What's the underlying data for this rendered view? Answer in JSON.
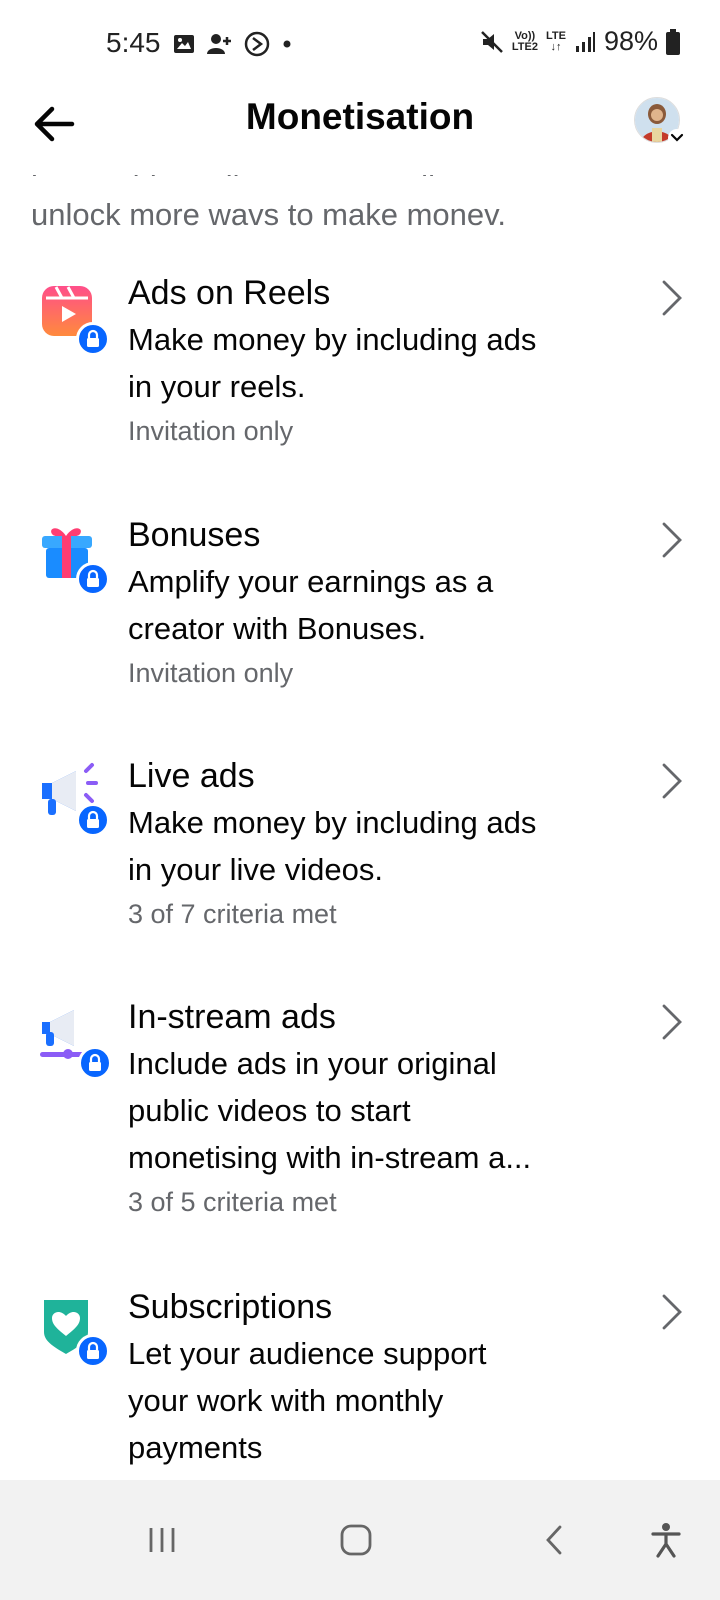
{
  "status_bar": {
    "time": "5:45",
    "net_volte": "Vo))",
    "net_lte2": "LTE2",
    "net_lte": "LTE",
    "battery": "98%",
    "icons": [
      "gallery-icon",
      "person-add-icon",
      "sync-icon",
      "dot-icon",
      "mute-icon",
      "signal-icon",
      "battery-icon"
    ]
  },
  "header": {
    "title": "Monetisation",
    "back_icon": "arrow-left-icon",
    "avatar_caret_icon": "chevron-down-icon"
  },
  "intro": {
    "clipped_line": "by reaching milestones, you'll",
    "visible_line": "unlock more wavs to make monev."
  },
  "items": [
    {
      "title": "Ads on Reels",
      "desc_1": "Make money by including ads",
      "desc_2": "in your reels.",
      "desc_3": "",
      "status": "Invitation only",
      "icon": "reels-icon"
    },
    {
      "title": "Bonuses",
      "desc_1": "Amplify your earnings as a",
      "desc_2": "creator with Bonuses.",
      "desc_3": "",
      "status": "Invitation only",
      "icon": "gift-icon"
    },
    {
      "title": "Live ads",
      "desc_1": "Make money by including ads",
      "desc_2": "in your live videos.",
      "desc_3": "",
      "status": "3 of 7 criteria met",
      "icon": "megaphone-icon"
    },
    {
      "title": "In-stream ads",
      "desc_1": "Include ads in your original",
      "desc_2": "public videos to start",
      "desc_3": "monetising with in-stream a...",
      "status": "3 of 5 criteria met",
      "icon": "instream-megaphone-icon"
    },
    {
      "title": "Subscriptions",
      "desc_1": "Let your audience support",
      "desc_2": "your work with monthly",
      "desc_3": "payments",
      "status": "",
      "icon": "heart-shield-icon"
    }
  ],
  "colors": {
    "accent_blue": "#0866ff",
    "secondary_text": "#65676b",
    "nav_bg": "#f2f2f2"
  },
  "nav": {
    "recents": "recents-icon",
    "home": "home-icon",
    "back": "back-icon",
    "accessibility": "accessibility-icon"
  }
}
